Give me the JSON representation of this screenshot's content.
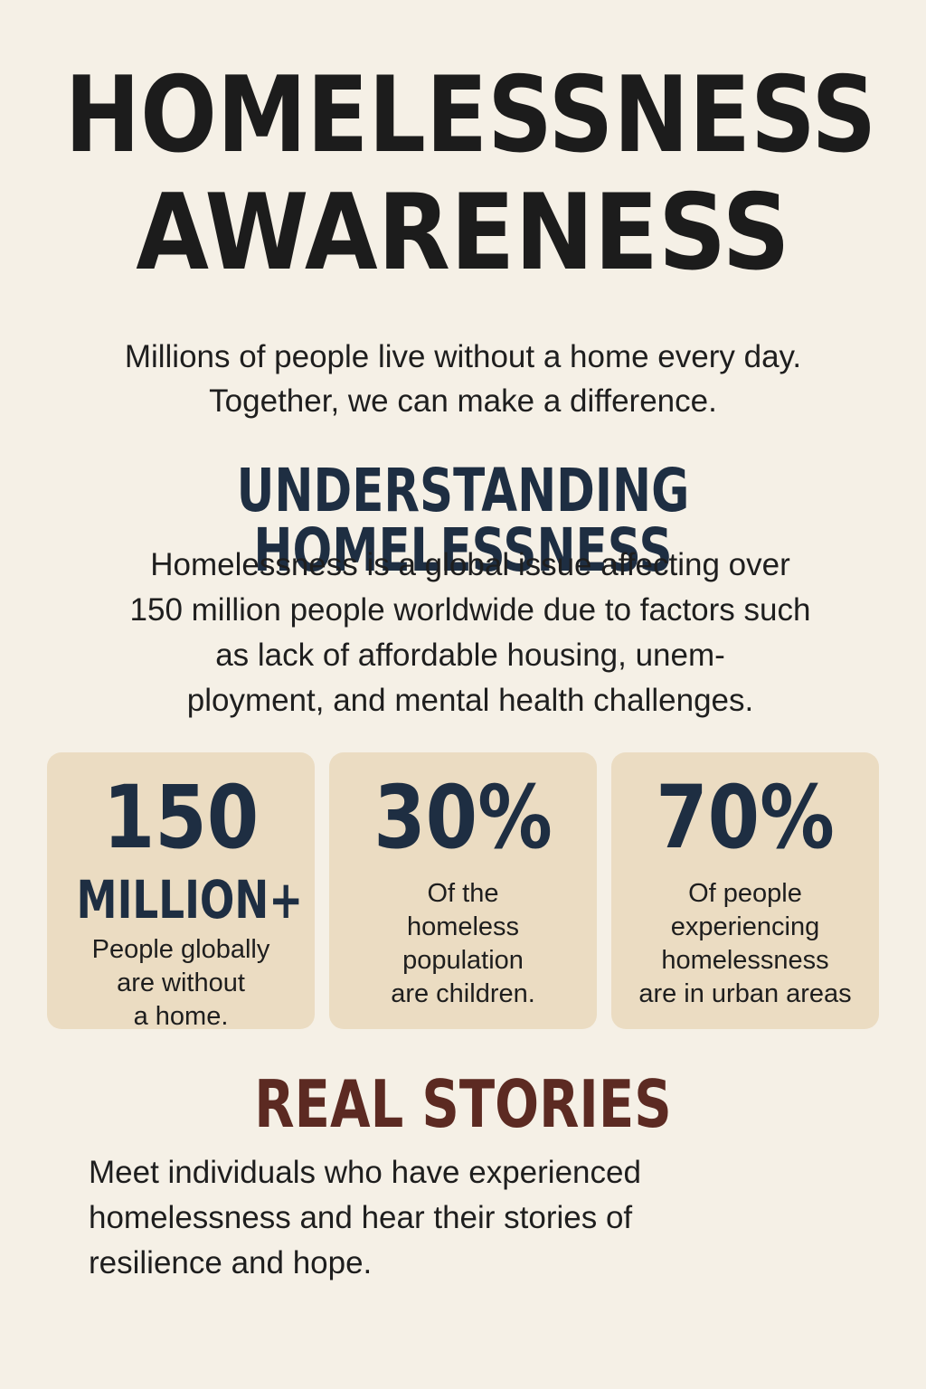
{
  "header": {
    "title_line1": "HOMELESSNESS",
    "title_line2": "AWARENESS",
    "intro_line1": "Millions of people live without a home every day.",
    "intro_line2": "Together, we can make a difference."
  },
  "understanding": {
    "title": "UNDERSTANDING HOMELESSNESS",
    "lines": [
      "Homelessness is a global issue affecting over",
      "150 million people worldwide due to factors such",
      "as lack of affordable housing, unem-",
      "ployment, and mental health challenges."
    ]
  },
  "stats": [
    {
      "value": "150",
      "value_sub": "MILLION+",
      "lines": [
        "People globally",
        "are without",
        "a home."
      ]
    },
    {
      "value": "30%",
      "lines": [
        "Of the",
        "homeless",
        "population",
        "are children."
      ]
    },
    {
      "value": "70%",
      "lines": [
        "Of people",
        "experiencing",
        "homelessness",
        "are in urban areas"
      ]
    }
  ],
  "stories": {
    "title": "REAL STORIES",
    "lines": [
      "Meet individuals who have experienced",
      "homelessness and hear their stories of",
      "resilience and hope."
    ]
  },
  "colors": {
    "background": "#f5f0e6",
    "card": "#ebdcc2",
    "navy": "#1e2e42",
    "maroon": "#5c2a22",
    "text": "#1e1e1e"
  }
}
